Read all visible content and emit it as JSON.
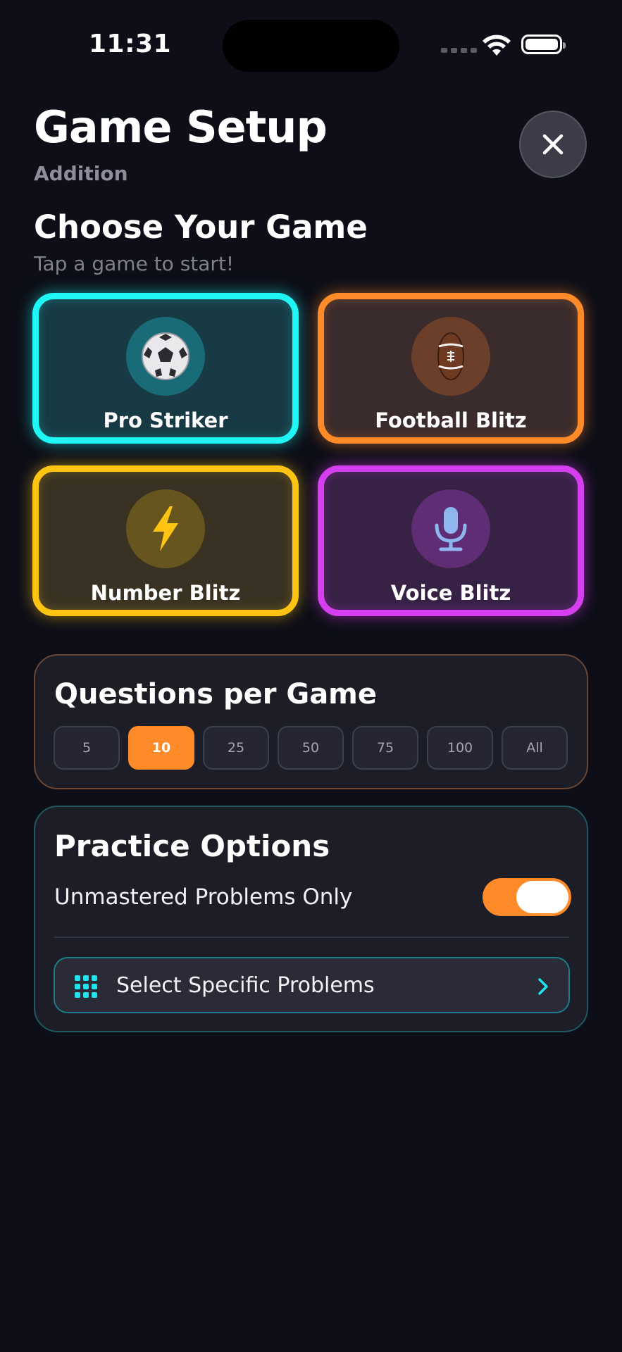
{
  "status_bar": {
    "time": "11:31"
  },
  "header": {
    "title": "Game Setup",
    "subtitle": "Addition"
  },
  "games_section": {
    "title": "Choose Your Game",
    "subtitle": "Tap a game to start!",
    "games": [
      {
        "label": "Pro Striker",
        "icon": "soccer-ball-icon",
        "color": "#1ff6f6"
      },
      {
        "label": "Football Blitz",
        "icon": "american-football-icon",
        "color": "#ff8a2a"
      },
      {
        "label": "Number Blitz",
        "icon": "lightning-bolt-icon",
        "color": "#ffc412"
      },
      {
        "label": "Voice Blitz",
        "icon": "microphone-icon",
        "color": "#d63ff0"
      }
    ]
  },
  "questions": {
    "title": "Questions per Game",
    "options": [
      "5",
      "10",
      "25",
      "50",
      "75",
      "100",
      "All"
    ],
    "selected": "10"
  },
  "practice": {
    "title": "Practice Options",
    "unmastered_label": "Unmastered Problems Only",
    "unmastered_enabled": true,
    "select_label": "Select Specific Problems"
  },
  "colors": {
    "accent": "#ff8a28",
    "teal": "#20e3ee",
    "background": "#0d0e17"
  }
}
